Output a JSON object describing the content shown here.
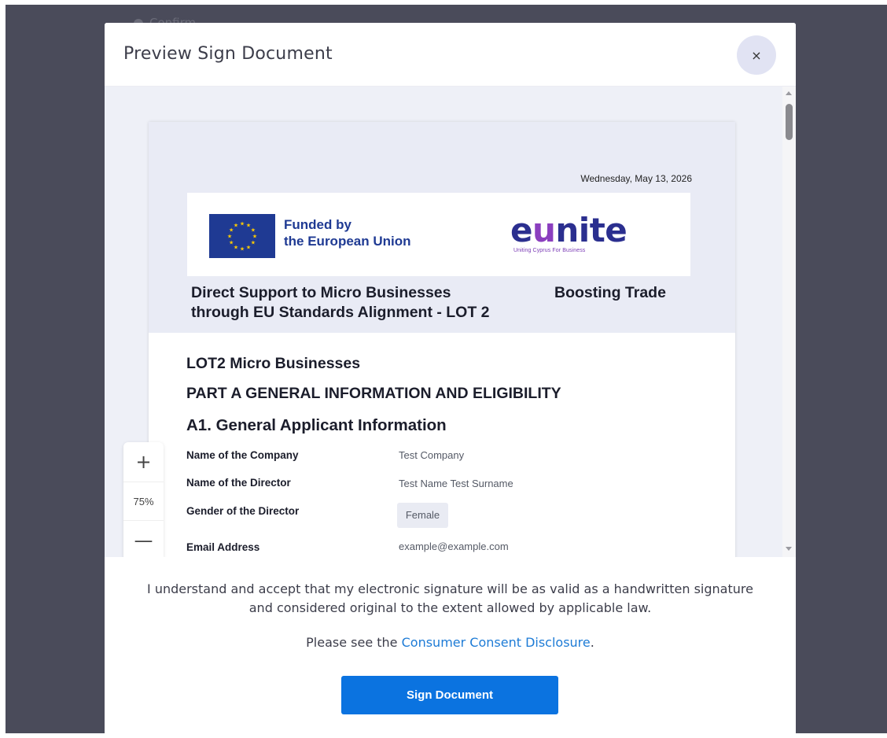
{
  "background": {
    "faded_label": "Confirm"
  },
  "modal": {
    "title": "Preview Sign Document",
    "close_label": "×"
  },
  "document": {
    "date": "Wednesday, May 13, 2026",
    "funded_line1": "Funded by",
    "funded_line2": "the European Union",
    "eunite_logo": "eunite",
    "eunite_tagline": "Uniting Cyprus For Business",
    "program_title_line1": "Direct Support to Micro Businesses",
    "program_title_line2": "through EU Standards Alignment - LOT 2",
    "boosting": "Boosting Trade",
    "heading_lot": "LOT2 Micro Businesses",
    "heading_part": "PART A GENERAL INFORMATION AND ELIGIBILITY",
    "heading_a1": "A1.  General Applicant Information",
    "fields": [
      {
        "label": "Name of the Company",
        "value": "Test Company"
      },
      {
        "label": "Name of the Director",
        "value": "Test Name Test Surname"
      },
      {
        "label": "Gender of the Director",
        "value": "Female"
      },
      {
        "label": "Email Address",
        "value": "example@example.com"
      }
    ]
  },
  "zoom": {
    "in": "+",
    "level": "75%",
    "out": "—"
  },
  "footer": {
    "consent": "I understand and accept that my electronic signature will be as valid as a handwritten signature and considered original to the extent allowed by applicable law.",
    "disclosure_prefix": "Please see the ",
    "disclosure_link": "Consumer Consent Disclosure",
    "disclosure_suffix": ".",
    "sign_button": "Sign Document"
  },
  "colors": {
    "backdrop": "#4a4b5a",
    "primary_button": "#0b73e0",
    "link": "#1d7bd6",
    "doc_header_bg": "#e9ebf5",
    "eu_blue": "#1f3a93",
    "eu_star": "#ffcc00"
  },
  "icons": {
    "close": "close-icon",
    "zoom_in": "plus-icon",
    "zoom_out": "minus-icon"
  }
}
